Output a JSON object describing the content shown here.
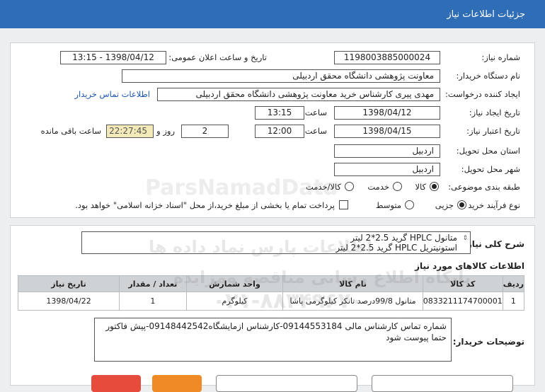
{
  "title": "جزئیات اطلاعات نیاز",
  "fields": {
    "need_number": {
      "label": "شماره نیاز:",
      "value": "1198003885000024"
    },
    "announce": {
      "label": "تاریخ و ساعت اعلان عمومی:",
      "value": "1398/04/12 - 13:15"
    },
    "buyer_org": {
      "label": "نام دستگاه خریدار:",
      "value": "معاونت پژوهشی دانشگاه محقق اردبیلی"
    },
    "requester": {
      "label": "ایجاد کننده درخواست:",
      "value": "مهدی پیری کارشناس خرید معاونت پژوهشی دانشگاه محقق اردبیلی",
      "link": "اطلاعات تماس خریدار"
    },
    "created": {
      "label": "تاریخ ایجاد نیاز:",
      "date": "1398/04/12",
      "time_label": "ساعت",
      "time": "13:15"
    },
    "validity": {
      "label": "تاریخ اعتبار نیاز:",
      "date": "1398/04/15",
      "time_label": "ساعت",
      "time": "12:00",
      "days": "2",
      "days_label": "روز و",
      "remaining": "22:27:45",
      "remaining_label": "ساعت باقی مانده"
    },
    "province": {
      "label": "استان محل تحویل:",
      "value": "اردبیل"
    },
    "city": {
      "label": "شهر محل تحویل:",
      "value": "اردبیل"
    },
    "category": {
      "label": "طبقه بندی موضوعی:",
      "options": [
        "کالا",
        "خدمت",
        "کالا/خدمت"
      ],
      "selected": "کالا"
    },
    "process": {
      "label": "نوع فرآیند خرید :",
      "options": [
        "جزیی",
        "متوسط"
      ],
      "selected": "جزیی",
      "note": "پرداخت تمام یا بخشی از مبلغ خرید،از محل \"اسناد خزانه اسلامی\" خواهد بود."
    }
  },
  "summary": {
    "label": "شرح کلی نیاز:",
    "line1": "متانول HPLC گرید 2.5*2 لیتر",
    "line2": "استونیتریل HPLC گرید 2.5*2 لیتر"
  },
  "goods_title": "اطلاعات کالاهای مورد نیاز",
  "table": {
    "headers": [
      "ردیف",
      "کد کالا",
      "نام کالا",
      "واحد شمارش",
      "تعداد / مقدار",
      "تاریخ نیاز"
    ],
    "rows": [
      [
        "1",
        "0833211174700001",
        "متانول 99/8درصد تانکر کیلوگرمی پاشا",
        "کیلوگرم",
        "1",
        "1398/04/22"
      ]
    ]
  },
  "notes": {
    "label": "توضیحات خریدار:",
    "text": "شماره تماس کارشناس مالی 09144553184-کارشناس ازمایشگاه09148442542-پیش فاکتور حتما پیوست شود"
  },
  "watermarks": [
    "ParsNamadData",
    "پایگاه اطلاع رسانی مناقصه ومزایده",
    "۰۲۱-۸۸۳۴۹۶۷۰",
    "اطلاعات پارس نماد داده ها"
  ],
  "colors": {
    "header": "#2f6eb6",
    "link": "#1a56b0",
    "remaining_bg": "#f4e9b8"
  }
}
